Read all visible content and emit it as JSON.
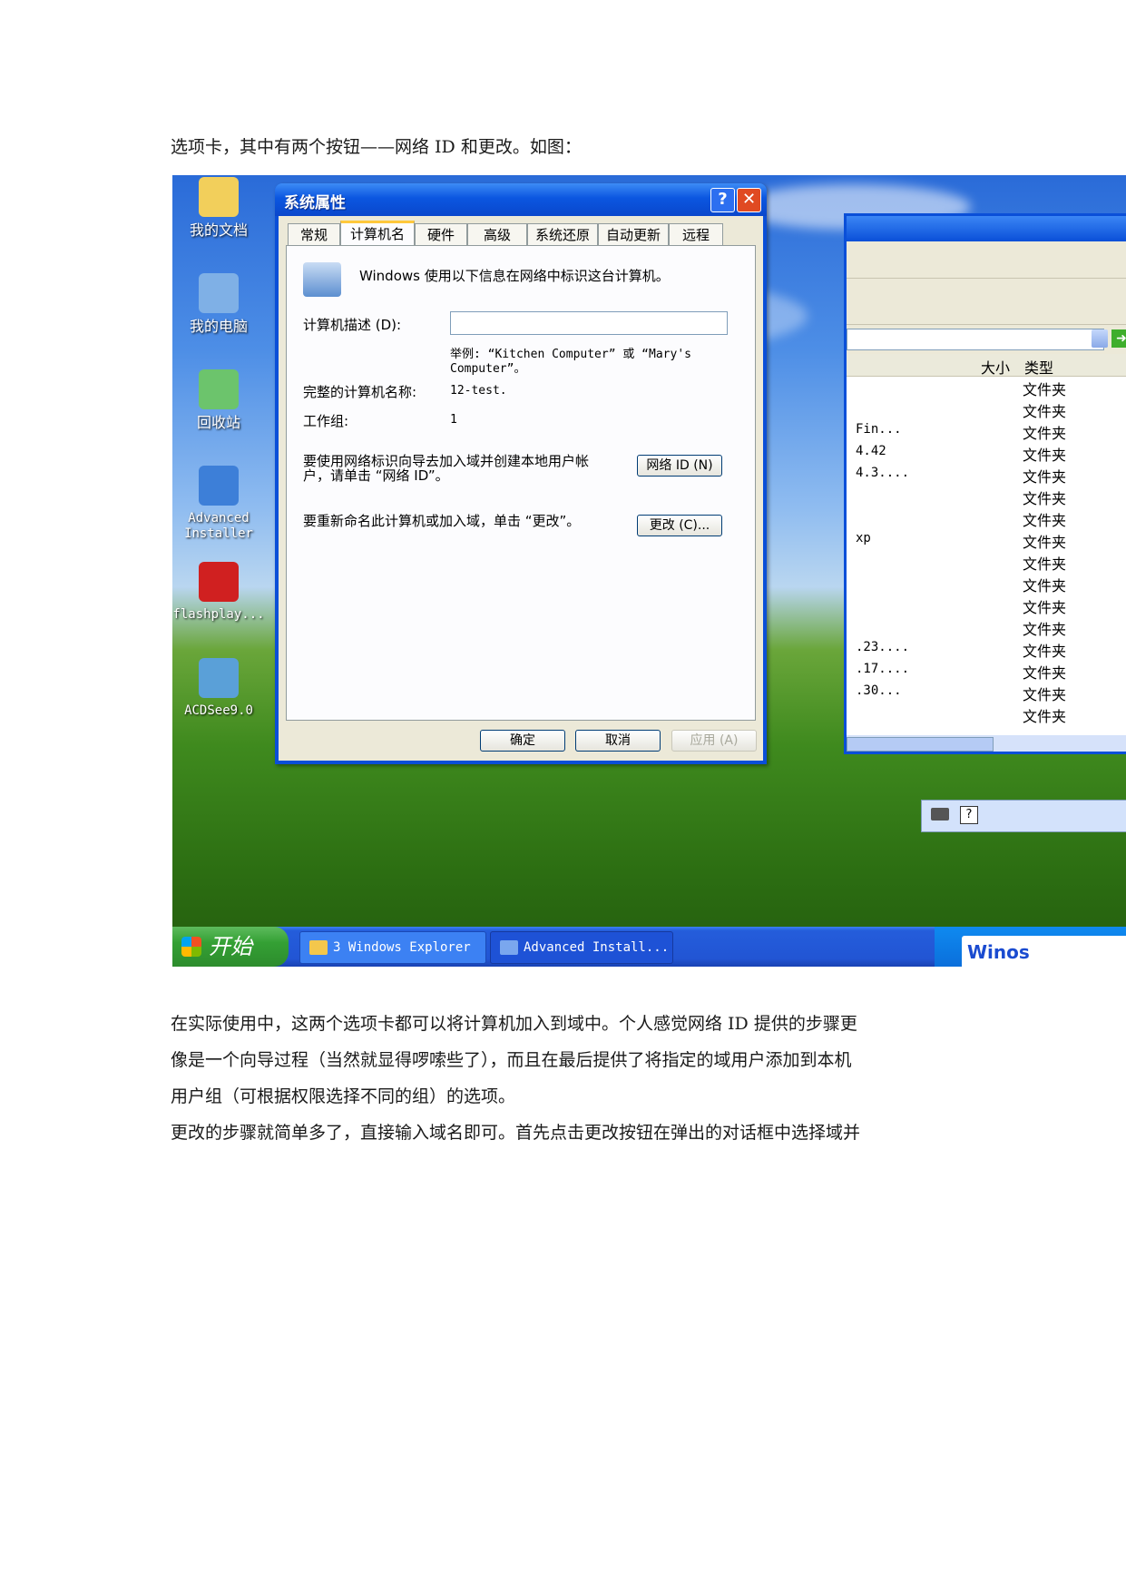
{
  "doc": {
    "intro": "选项卡，其中有两个按钮——网络 ID 和更改。如图：",
    "paragraph1_line1": "在实际使用中，这两个选项卡都可以将计算机加入到域中。个人感觉网络 ID 提供的步骤更",
    "paragraph1_line2": "像是一个向导过程（当然就显得啰嗦些了），而且在最后提供了将指定的域用户添加到本机",
    "paragraph1_line3": "用户组（可根据权限选择不同的组）的选项。",
    "paragraph2_line1": "更改的步骤就简单多了，直接输入域名即可。首先点击更改按钮在弹出的对话框中选择域并"
  },
  "desktop": {
    "icons": [
      {
        "label": "我的文档",
        "icon": "my-documents-icon",
        "color": "#f2cf5b"
      },
      {
        "label": "我的电脑",
        "icon": "my-computer-icon",
        "color": "#7fb0e6"
      },
      {
        "label": "回收站",
        "icon": "recycle-bin-icon",
        "color": "#6cc46c"
      },
      {
        "label": "Advanced\nInstaller",
        "icon": "advanced-installer-icon",
        "color": "#3d7fd8"
      },
      {
        "label": "flashplay...",
        "icon": "flash-player-icon",
        "color": "#d02020"
      },
      {
        "label": "ACDSee9.0",
        "icon": "acdsee-icon",
        "color": "#5aa0d8"
      }
    ]
  },
  "explorer": {
    "col_size": "大小",
    "col_type": "类型",
    "rows": [
      {
        "name": "",
        "type": "文件夹"
      },
      {
        "name": "",
        "type": "文件夹"
      },
      {
        "name": "Fin...",
        "type": "文件夹"
      },
      {
        "name": "4.42",
        "type": "文件夹"
      },
      {
        "name": "4.3....",
        "type": "文件夹"
      },
      {
        "name": "",
        "type": "文件夹"
      },
      {
        "name": "",
        "type": "文件夹"
      },
      {
        "name": "xp",
        "type": "文件夹"
      },
      {
        "name": "",
        "type": "文件夹"
      },
      {
        "name": "",
        "type": "文件夹"
      },
      {
        "name": "",
        "type": "文件夹"
      },
      {
        "name": "",
        "type": "文件夹"
      },
      {
        "name": ".23....",
        "type": "文件夹"
      },
      {
        "name": ".17....",
        "type": "文件夹"
      },
      {
        "name": ".30...",
        "type": "文件夹"
      },
      {
        "name": "",
        "type": "文件夹"
      }
    ]
  },
  "dialog": {
    "title": "系统属性",
    "help_label": "?",
    "close_label": "✕",
    "tabs": [
      "常规",
      "计算机名",
      "硬件",
      "高级",
      "系统还原",
      "自动更新",
      "远程"
    ],
    "info_text": "Windows 使用以下信息在网络中标识这台计算机。",
    "desc_label": "计算机描述 (D):",
    "desc_value": "",
    "example_line1": "举例: “Kitchen Computer” 或 “Mary's",
    "example_line2": "Computer”。",
    "fullname_label": "完整的计算机名称:",
    "fullname_value": "12-test.",
    "workgroup_label": "工作组:",
    "workgroup_value": "1",
    "network_text_line1": "要使用网络标识向导去加入域并创建本地用户帐",
    "network_text_line2": "户，请单击 “网络 ID”。",
    "network_button": "网络 ID (N)",
    "rename_text": "要重新命名此计算机或加入域，单击 “更改”。",
    "change_button": "更改 (C)...",
    "ok_button": "确定",
    "cancel_button": "取消",
    "apply_button": "应用 (A)"
  },
  "taskbar": {
    "start_label": "开始",
    "task1": "3 Windows Explorer",
    "task2": "Advanced Install...",
    "tray_logo": "Winos"
  }
}
